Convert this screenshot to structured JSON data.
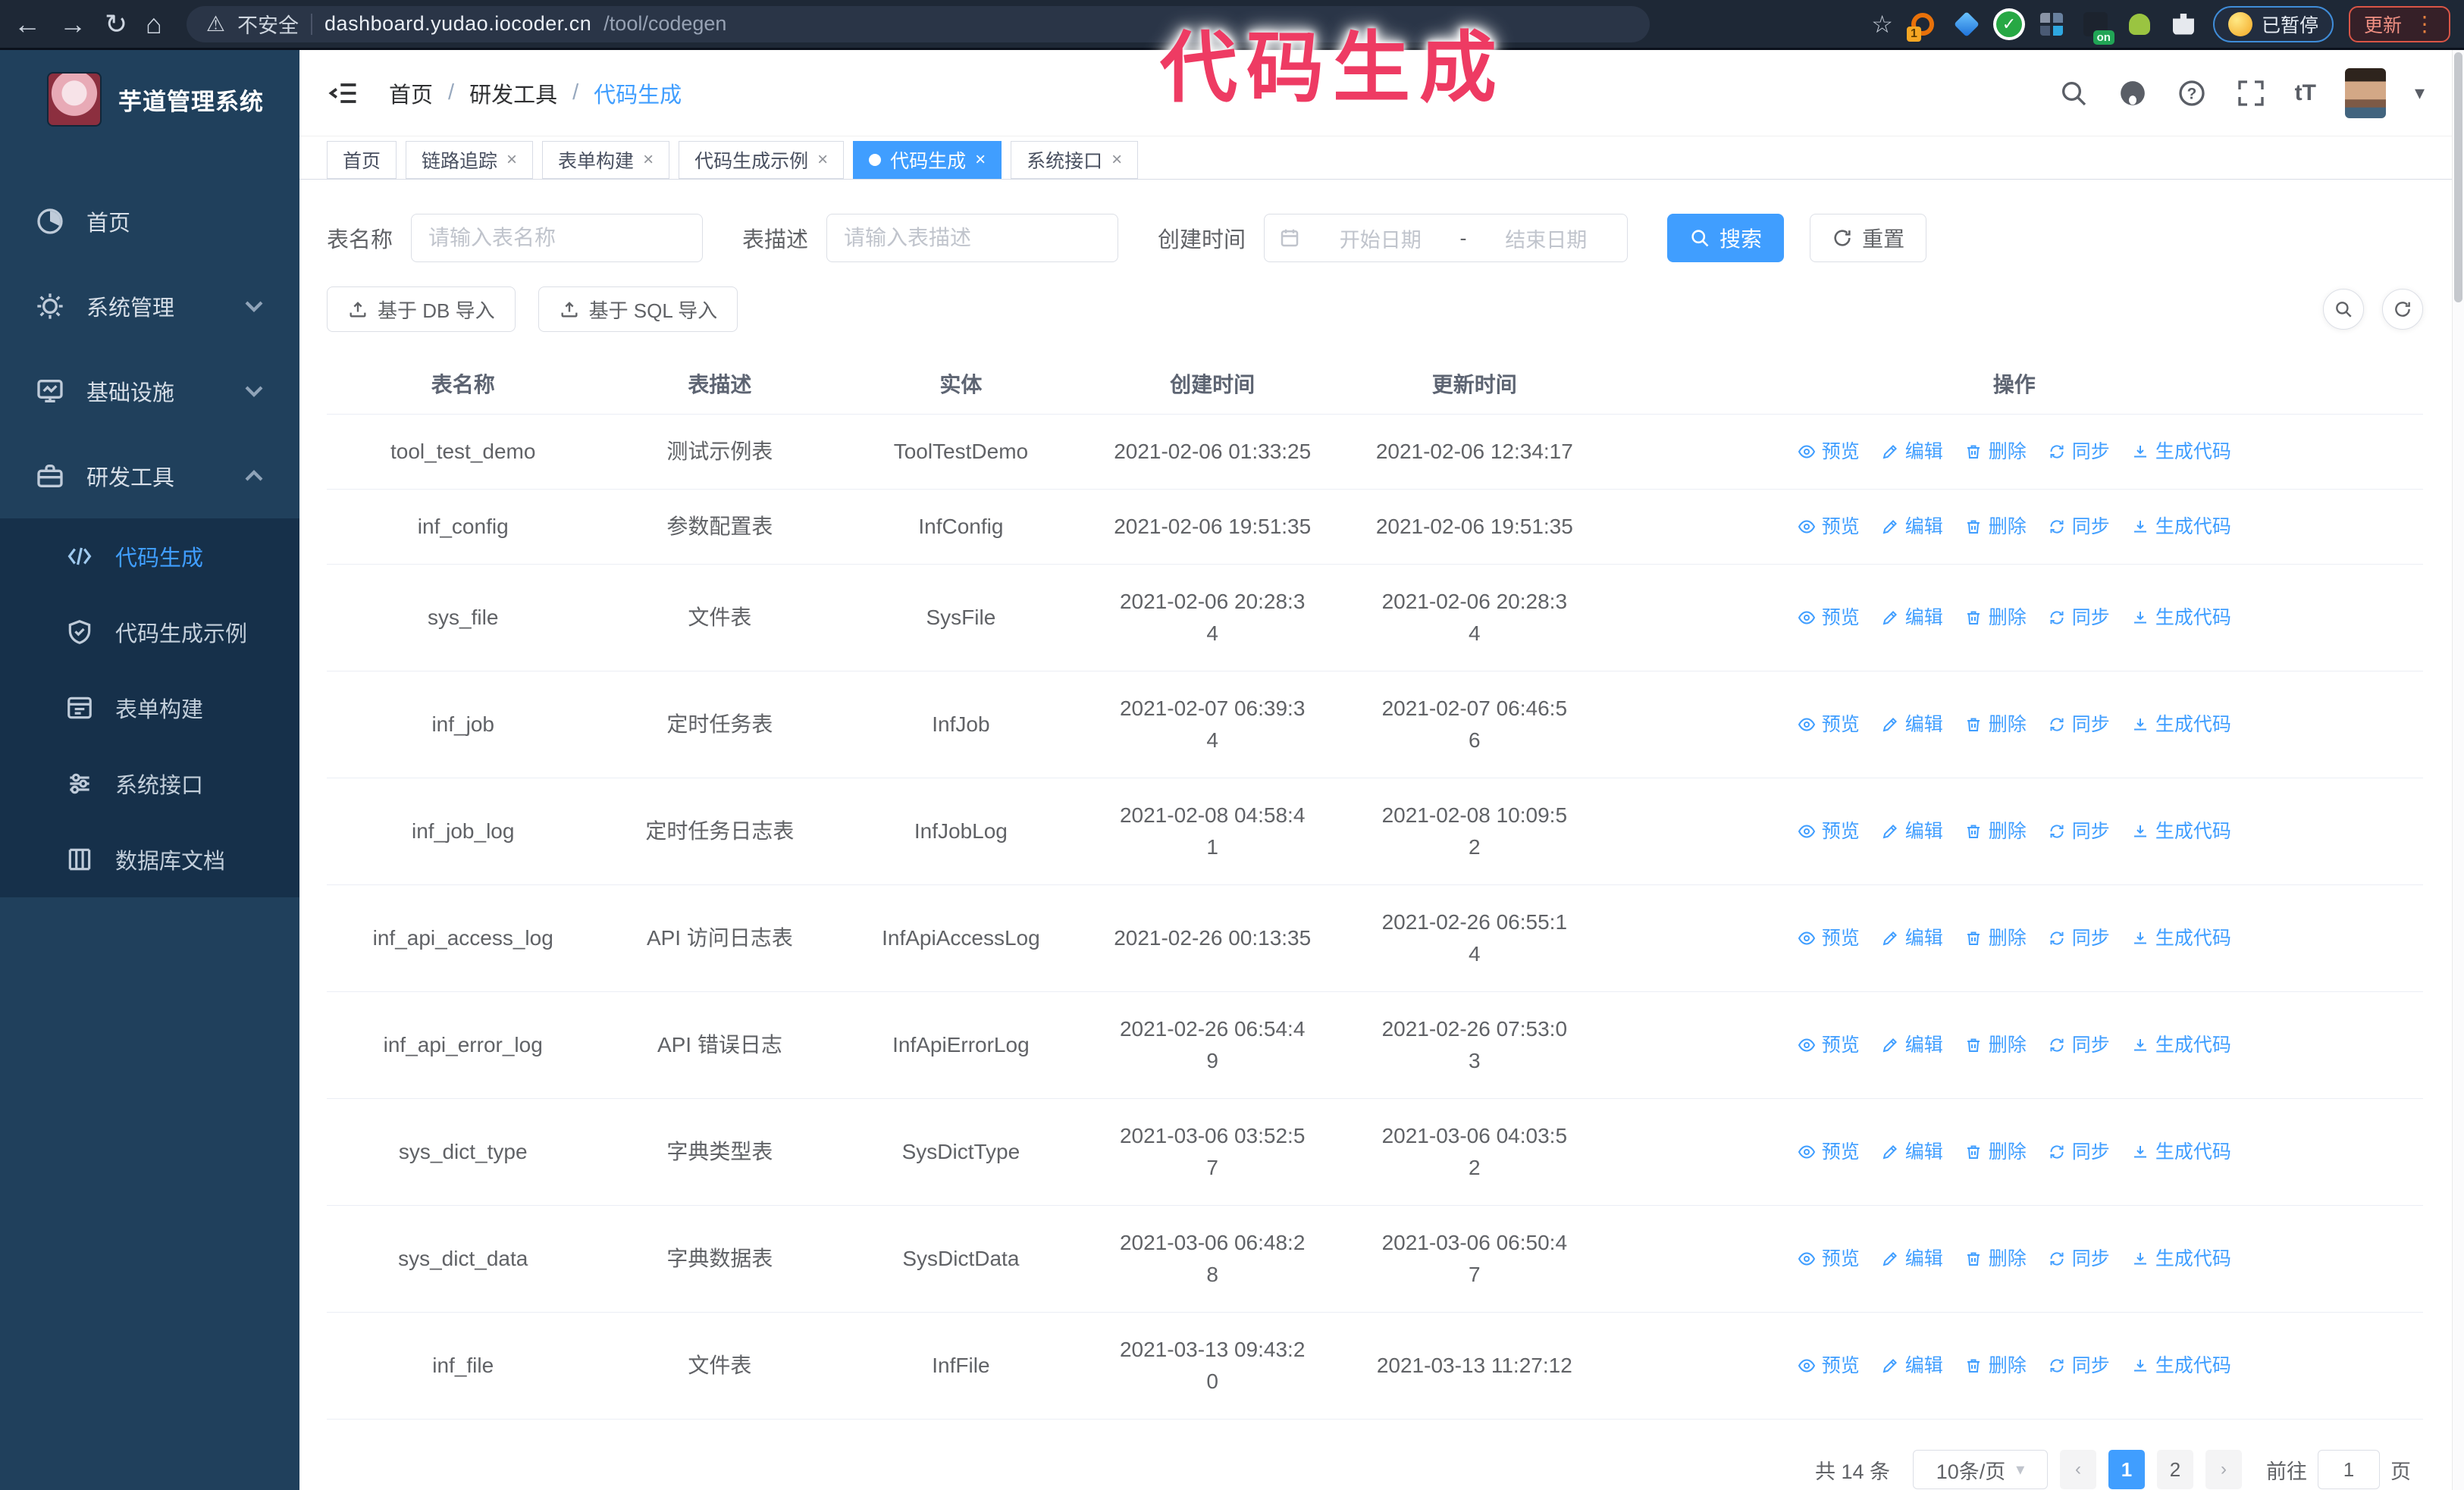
{
  "overlay": {
    "caption": "代码生成",
    "color": "#ee3b63"
  },
  "browser": {
    "security_label": "不安全",
    "url_host": "dashboard.yudao.iocoder.cn",
    "url_path": "/tool/codegen",
    "extension_badge": "1",
    "extension_on_badge": "on",
    "paused_badge": "已暂停",
    "update_button": "更新"
  },
  "sidebar": {
    "app_title": "芋道管理系统",
    "items": [
      {
        "label": "首页"
      },
      {
        "label": "系统管理"
      },
      {
        "label": "基础设施"
      },
      {
        "label": "研发工具"
      }
    ],
    "subitems": [
      {
        "label": "代码生成"
      },
      {
        "label": "代码生成示例"
      },
      {
        "label": "表单构建"
      },
      {
        "label": "系统接口"
      },
      {
        "label": "数据库文档"
      }
    ]
  },
  "header": {
    "breadcrumb": [
      "首页",
      "研发工具",
      "代码生成"
    ]
  },
  "tabs": [
    {
      "label": "首页"
    },
    {
      "label": "链路追踪"
    },
    {
      "label": "表单构建"
    },
    {
      "label": "代码生成示例"
    },
    {
      "label": "代码生成"
    },
    {
      "label": "系统接口"
    }
  ],
  "filters": {
    "name_label": "表名称",
    "name_placeholder": "请输入表名称",
    "desc_label": "表描述",
    "desc_placeholder": "请输入表描述",
    "time_label": "创建时间",
    "start_placeholder": "开始日期",
    "range_separator": "-",
    "end_placeholder": "结束日期",
    "search_button": "搜索",
    "reset_button": "重置"
  },
  "toolbar": {
    "import_db": "基于 DB 导入",
    "import_sql": "基于 SQL 导入"
  },
  "table": {
    "columns": [
      "表名称",
      "表描述",
      "实体",
      "创建时间",
      "更新时间",
      "操作"
    ],
    "actions": [
      "预览",
      "编辑",
      "删除",
      "同步",
      "生成代码"
    ],
    "rows": [
      {
        "name": "tool_test_demo",
        "desc": "测试示例表",
        "entity": "ToolTestDemo",
        "created": "2021-02-06 01:33:25",
        "updated": "2021-02-06 12:34:17"
      },
      {
        "name": "inf_config",
        "desc": "参数配置表",
        "entity": "InfConfig",
        "created": "2021-02-06 19:51:35",
        "updated": "2021-02-06 19:51:35"
      },
      {
        "name": "sys_file",
        "desc": "文件表",
        "entity": "SysFile",
        "created": "2021-02-06 20:28:3\n4",
        "updated": "2021-02-06 20:28:3\n4"
      },
      {
        "name": "inf_job",
        "desc": "定时任务表",
        "entity": "InfJob",
        "created": "2021-02-07 06:39:3\n4",
        "updated": "2021-02-07 06:46:5\n6"
      },
      {
        "name": "inf_job_log",
        "desc": "定时任务日志表",
        "entity": "InfJobLog",
        "created": "2021-02-08 04:58:4\n1",
        "updated": "2021-02-08 10:09:5\n2"
      },
      {
        "name": "inf_api_access_log",
        "desc": "API 访问日志表",
        "entity": "InfApiAccessLog",
        "created": "2021-02-26 00:13:35",
        "updated": "2021-02-26 06:55:1\n4"
      },
      {
        "name": "inf_api_error_log",
        "desc": "API 错误日志",
        "entity": "InfApiErrorLog",
        "created": "2021-02-26 06:54:4\n9",
        "updated": "2021-02-26 07:53:0\n3"
      },
      {
        "name": "sys_dict_type",
        "desc": "字典类型表",
        "entity": "SysDictType",
        "created": "2021-03-06 03:52:5\n7",
        "updated": "2021-03-06 04:03:5\n2"
      },
      {
        "name": "sys_dict_data",
        "desc": "字典数据表",
        "entity": "SysDictData",
        "created": "2021-03-06 06:48:2\n8",
        "updated": "2021-03-06 06:50:4\n7"
      },
      {
        "name": "inf_file",
        "desc": "文件表",
        "entity": "InfFile",
        "created": "2021-03-13 09:43:2\n0",
        "updated": "2021-03-13 11:27:12"
      }
    ]
  },
  "pagination": {
    "total": "共 14 条",
    "page_size": "10条/页",
    "pages": [
      "1",
      "2"
    ],
    "goto_label": "前往",
    "goto_value": "1",
    "page_suffix": "页"
  }
}
